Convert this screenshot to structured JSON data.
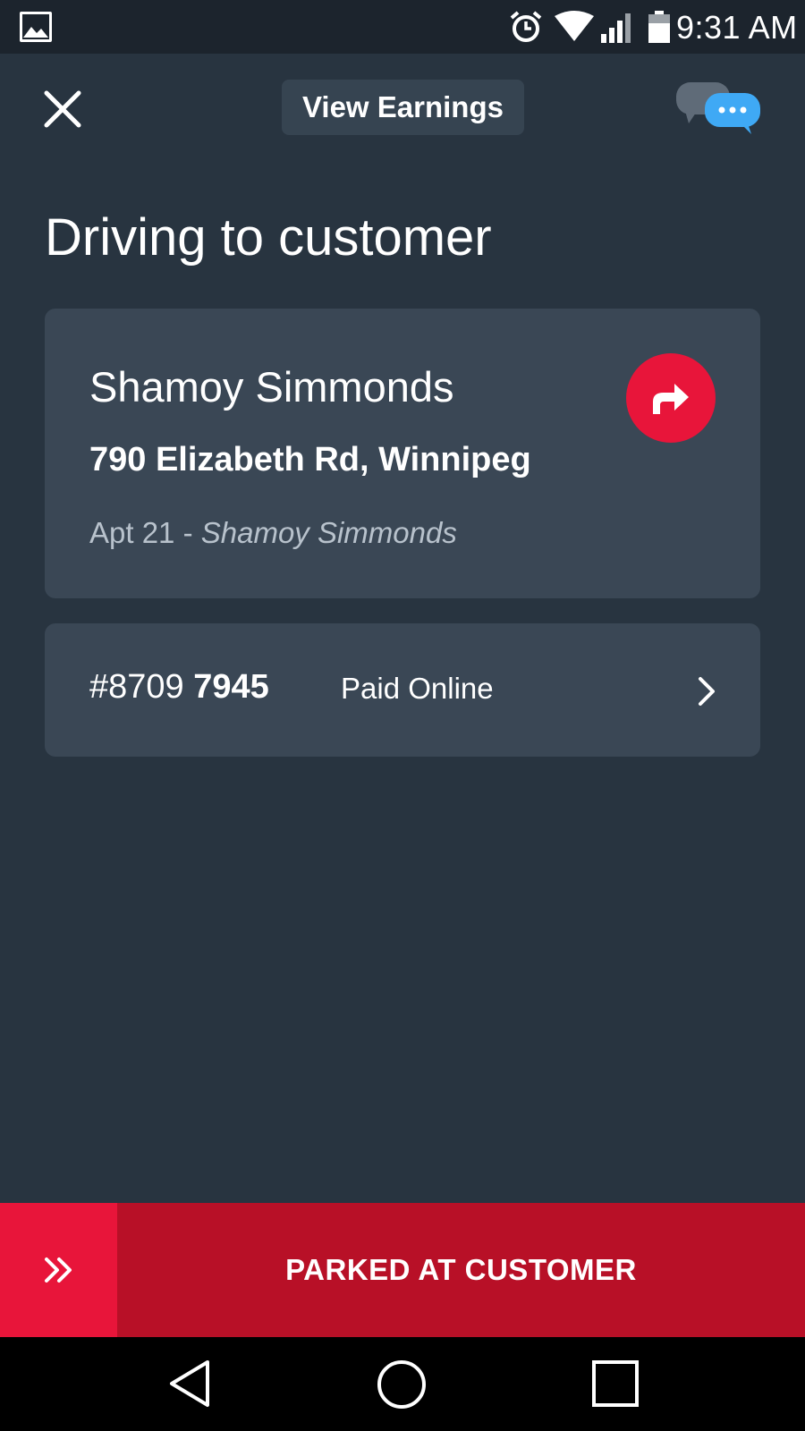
{
  "status_bar": {
    "time": "9:31 AM",
    "icons": [
      "gallery-icon",
      "alarm-icon",
      "wifi-icon",
      "signal-icon",
      "battery-icon"
    ]
  },
  "header": {
    "close_icon": "close-icon",
    "earnings_label": "View Earnings",
    "chat_icon": "chat-bubbles-icon"
  },
  "page": {
    "title": "Driving to customer"
  },
  "customer": {
    "name": "Shamoy Simmonds",
    "address": "790 Elizabeth Rd, Winnipeg",
    "apt_prefix": "Apt 21 - ",
    "apt_name": "Shamoy Simmonds",
    "navigate_icon": "navigate-arrow-icon"
  },
  "order": {
    "number_prefix": "#8709 ",
    "number_suffix": "7945",
    "payment": "Paid Online",
    "chevron_icon": "chevron-right-icon"
  },
  "action": {
    "label": "PARKED AT CUSTOMER",
    "slide_icon": "double-chevron-right-icon"
  },
  "colors": {
    "background": "#283440",
    "card": "#3a4755",
    "accent_red": "#e8153a",
    "action_dark_red": "#b81027",
    "chat_blue": "#3fa9f5"
  }
}
